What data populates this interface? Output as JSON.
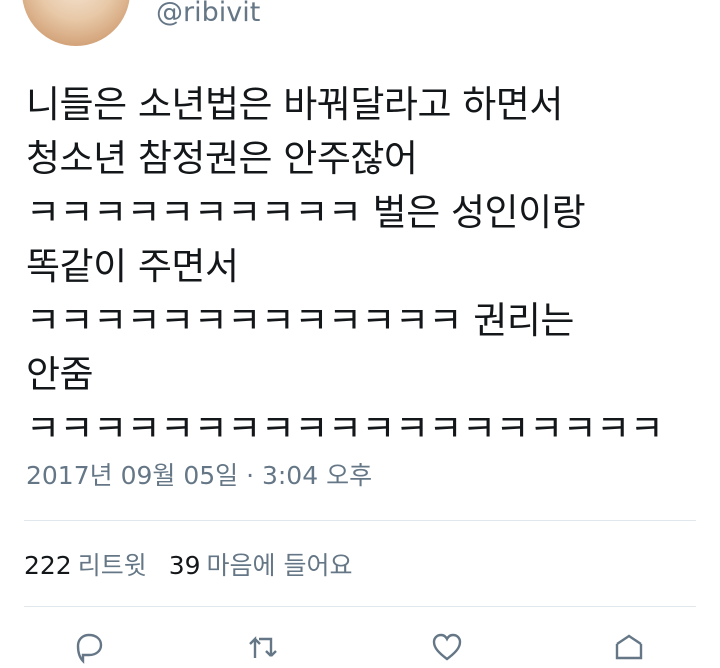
{
  "author": {
    "handle": "@ribivit"
  },
  "tweet": {
    "lines": [
      "니들은 소년법은 바꿔달라고 하면서",
      "청소년 참정권은 안주잖어",
      "ㅋㅋㅋㅋㅋㅋㅋㅋㅋㅋ 벌은 성인이랑",
      "똑같이 주면서",
      "ㅋㅋㅋㅋㅋㅋㅋㅋㅋㅋㅋㅋㅋ 권리는",
      "안줌",
      "ㅋㅋㅋㅋㅋㅋㅋㅋㅋㅋㅋㅋㅋㅋㅋㅋㅋㅋㅋ"
    ],
    "timestamp": "2017년 09월 05일 · 3:04 오후"
  },
  "stats": {
    "retweets_count": "222",
    "retweets_label": "리트윗",
    "likes_count": "39",
    "likes_label": "마음에 들어요"
  },
  "actions": {
    "icons": [
      "reply-icon",
      "retweet-icon",
      "like-icon",
      "share-icon"
    ],
    "icon_color": "#657786"
  },
  "colors": {
    "text": "#14171a",
    "secondary": "#657786",
    "divider": "#e1e8ed"
  }
}
